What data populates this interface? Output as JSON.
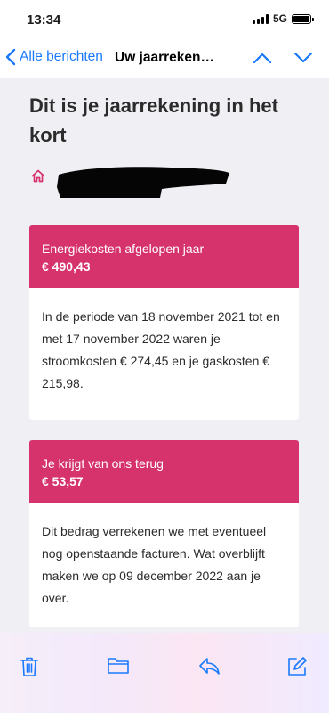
{
  "status": {
    "time": "13:34",
    "network": "5G"
  },
  "nav": {
    "back_label": "Alle berichten",
    "title": "Uw jaarreken…"
  },
  "headline": "Dit is je jaarrekening in het kort",
  "cards": [
    {
      "label": "Energiekosten afgelopen jaar",
      "amount": "€ 490,43",
      "body": "In de periode van 18 november 2021 tot en met 17 november 2022 waren je stroomkosten € 274,45 en je gaskosten € 215,98."
    },
    {
      "label": "Je krijgt van ons terug",
      "amount": "€ 53,57",
      "body": "Dit bedrag verrekenen we met eventueel nog openstaande facturen. Wat overblijft maken we op 09 december 2022 aan je over."
    }
  ],
  "colors": {
    "accent": "#d6326b",
    "link": "#1a7aff",
    "background": "#f0eff4"
  },
  "icons": {
    "home": "home-icon",
    "trash": "trash-icon",
    "folder": "folder-icon",
    "reply": "reply-icon",
    "compose": "compose-icon"
  }
}
